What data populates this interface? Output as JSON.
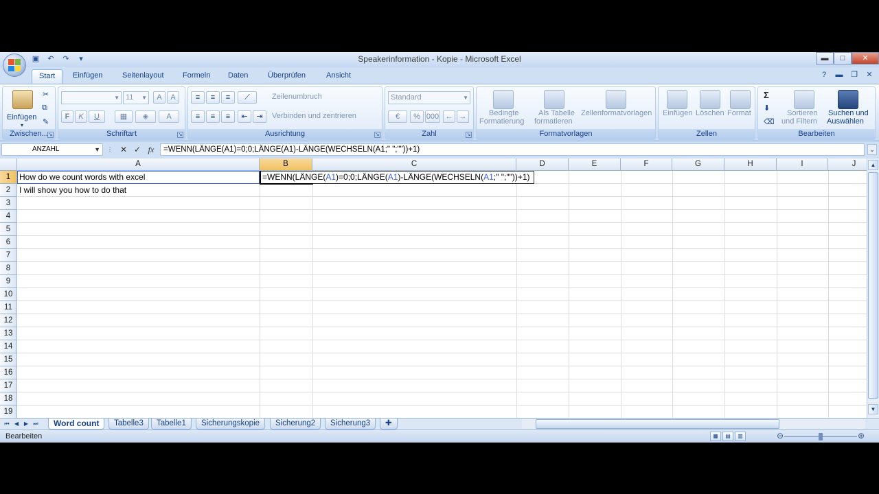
{
  "window": {
    "title": "Speakerinformation - Kopie - Microsoft Excel",
    "controls": {
      "minimize": "▬",
      "maximize": "□",
      "close": "✕"
    }
  },
  "qat": [
    "save-icon",
    "undo-icon",
    "redo-icon",
    "customize-icon"
  ],
  "tabs": [
    "Start",
    "Einfügen",
    "Seitenlayout",
    "Formeln",
    "Daten",
    "Überprüfen",
    "Ansicht"
  ],
  "ribbon": {
    "clipboard": {
      "paste_label": "Einfügen",
      "group_label": "Zwischen..."
    },
    "font": {
      "font_name": "",
      "font_size": "11",
      "bold": "F",
      "italic": "K",
      "underline": "U",
      "group_label": "Schriftart"
    },
    "alignment": {
      "wrap_label": "Zeilenumbruch",
      "merge_label": "Verbinden und zentrieren",
      "group_label": "Ausrichtung"
    },
    "number": {
      "format_value": "Standard",
      "percent": "%",
      "thousands": "000",
      "group_label": "Zahl"
    },
    "styles": {
      "conditional_1": "Bedingte",
      "conditional_2": "Formatierung",
      "table_1": "Als Tabelle",
      "table_2": "formatieren",
      "cell_styles": "Zellenformatvorlagen",
      "group_label": "Formatvorlagen"
    },
    "cells": {
      "insert": "Einfügen",
      "delete": "Löschen",
      "format": "Format",
      "group_label": "Zellen"
    },
    "editing": {
      "sort_1": "Sortieren",
      "sort_2": "und Filtern",
      "find_1": "Suchen und",
      "find_2": "Auswählen",
      "group_label": "Bearbeiten",
      "sum_symbol": "Σ"
    }
  },
  "formula_bar": {
    "name_box": "ANZAHL",
    "formula": "=WENN(LÄNGE(A1)=0;0;LÄNGE(A1)-LÄNGE(WECHSELN(A1;\" \";\"\"))+1)",
    "cancel": "✕",
    "enter": "✓",
    "fx": "fx"
  },
  "grid": {
    "columns": [
      "A",
      "B",
      "C",
      "D",
      "E",
      "F",
      "G",
      "H",
      "I",
      "J"
    ],
    "rows": [
      "1",
      "2",
      "3",
      "4",
      "5",
      "6",
      "7",
      "8",
      "9",
      "10",
      "11",
      "12",
      "13",
      "14",
      "15",
      "16",
      "17",
      "18",
      "19"
    ],
    "cells": {
      "A1": "How do we count words with excel",
      "A2": "I will show you how to do that"
    },
    "edit_cell": {
      "p1": "=WENN(LÄNGE(",
      "r1": "A1",
      "p2": ")=0;0;LÄNGE(",
      "r2": "A1",
      "p3": ")-LÄNGE(WECHSELN(",
      "r3": "A1",
      "p4": ";\" \";\"\"))+1)"
    }
  },
  "sheets": [
    "Word count",
    "Tabelle3",
    "Tabelle1",
    "Sicherungskopie",
    "Sicherung2",
    "Sicherung3"
  ],
  "status": {
    "mode": "Bearbeiten"
  }
}
